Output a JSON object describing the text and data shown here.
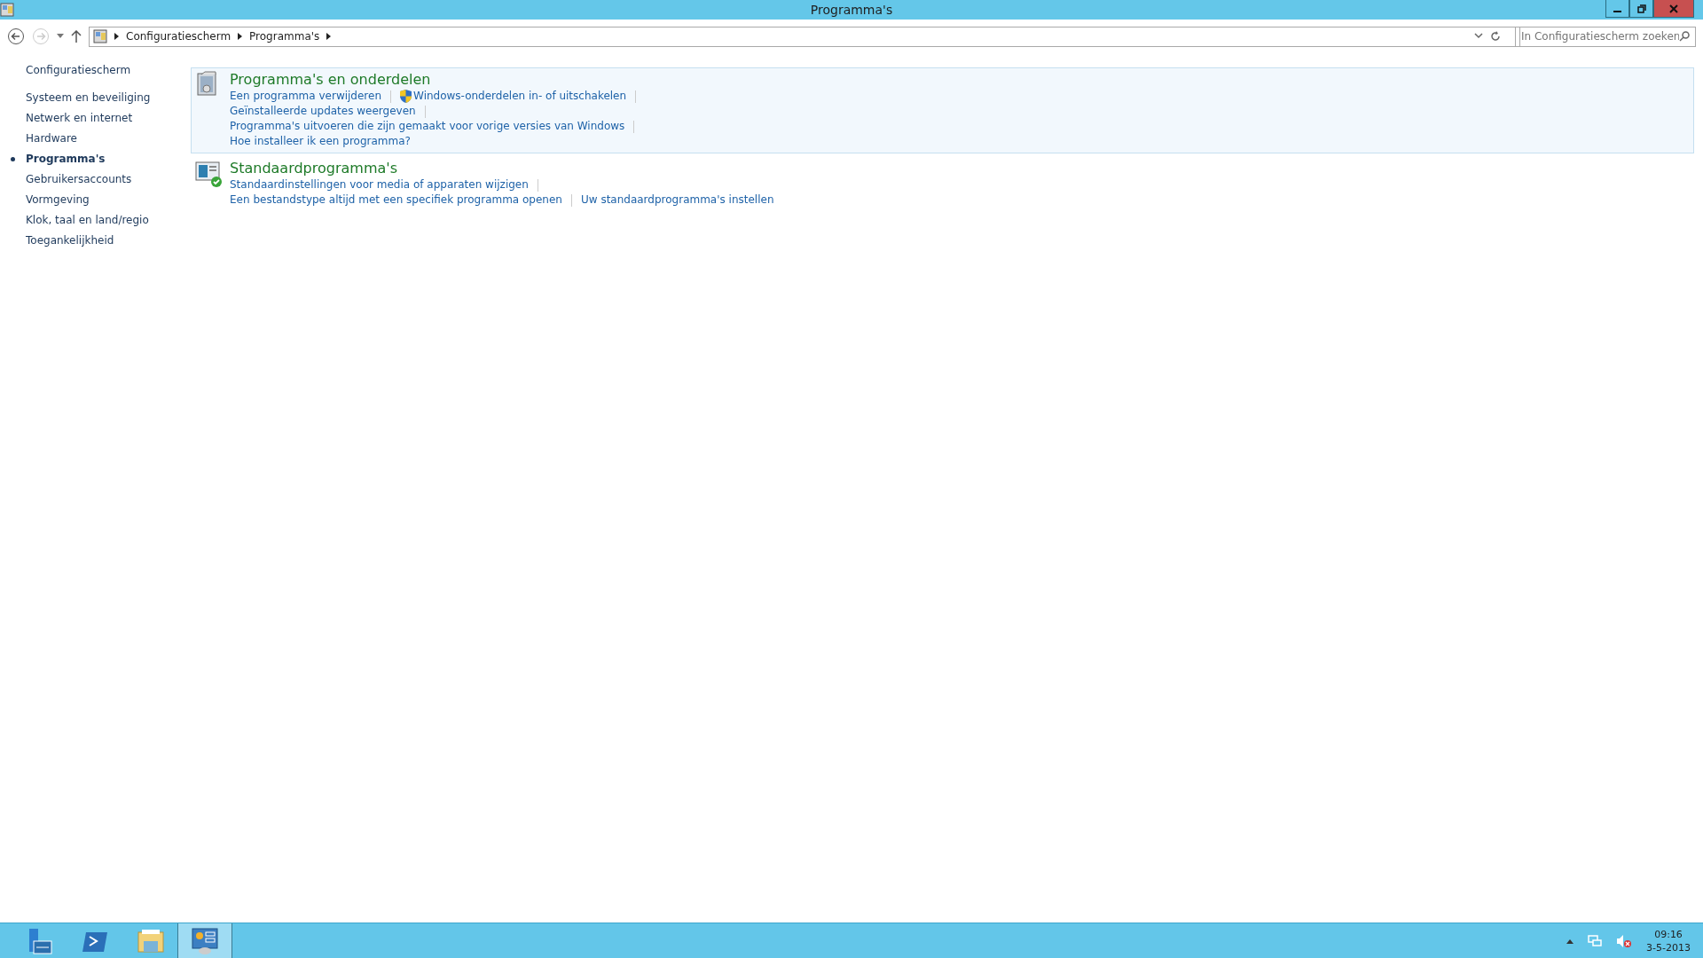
{
  "window": {
    "title": "Programma's"
  },
  "address": {
    "crumbs": [
      "Configuratiescherm",
      "Programma's"
    ]
  },
  "search": {
    "placeholder": "In Configuratiescherm zoeken"
  },
  "sidebar": {
    "home": "Configuratiescherm",
    "items": [
      {
        "label": "Systeem en beveiliging",
        "selected": false
      },
      {
        "label": "Netwerk en internet",
        "selected": false
      },
      {
        "label": "Hardware",
        "selected": false
      },
      {
        "label": "Programma's",
        "selected": true
      },
      {
        "label": "Gebruikersaccounts",
        "selected": false
      },
      {
        "label": "Vormgeving",
        "selected": false
      },
      {
        "label": "Klok, taal en land/regio",
        "selected": false
      },
      {
        "label": "Toegankelijkheid",
        "selected": false
      }
    ]
  },
  "categories": [
    {
      "kind": "programs",
      "title": "Programma's en onderdelen",
      "highlighted": true,
      "rows": [
        [
          {
            "label": "Een programma verwijderen",
            "shield": false,
            "divider": true
          },
          {
            "label": "Windows-onderdelen in- of uitschakelen",
            "shield": true,
            "divider": true
          }
        ],
        [
          {
            "label": "Geïnstalleerde updates weergeven",
            "shield": false,
            "divider": true
          }
        ],
        [
          {
            "label": "Programma's uitvoeren die zijn gemaakt voor vorige versies van Windows",
            "shield": false,
            "divider": true
          }
        ],
        [
          {
            "label": "Hoe installeer ik een programma?",
            "shield": false,
            "divider": false
          }
        ]
      ]
    },
    {
      "kind": "defaults",
      "title": "Standaardprogramma's",
      "highlighted": false,
      "rows": [
        [
          {
            "label": "Standaardinstellingen voor media of apparaten wijzigen",
            "shield": false,
            "divider": true
          }
        ],
        [
          {
            "label": "Een bestandstype altijd met een specifiek programma openen",
            "shield": false,
            "divider": true
          },
          {
            "label": "Uw standaardprogramma's instellen",
            "shield": false,
            "divider": false
          }
        ]
      ]
    }
  ],
  "taskbar": {
    "apps": [
      {
        "kind": "server",
        "selected": false
      },
      {
        "kind": "powershell",
        "selected": false
      },
      {
        "kind": "explorer",
        "selected": false
      },
      {
        "kind": "control",
        "selected": true
      }
    ],
    "time": "09:16",
    "date": "3-5-2013"
  }
}
